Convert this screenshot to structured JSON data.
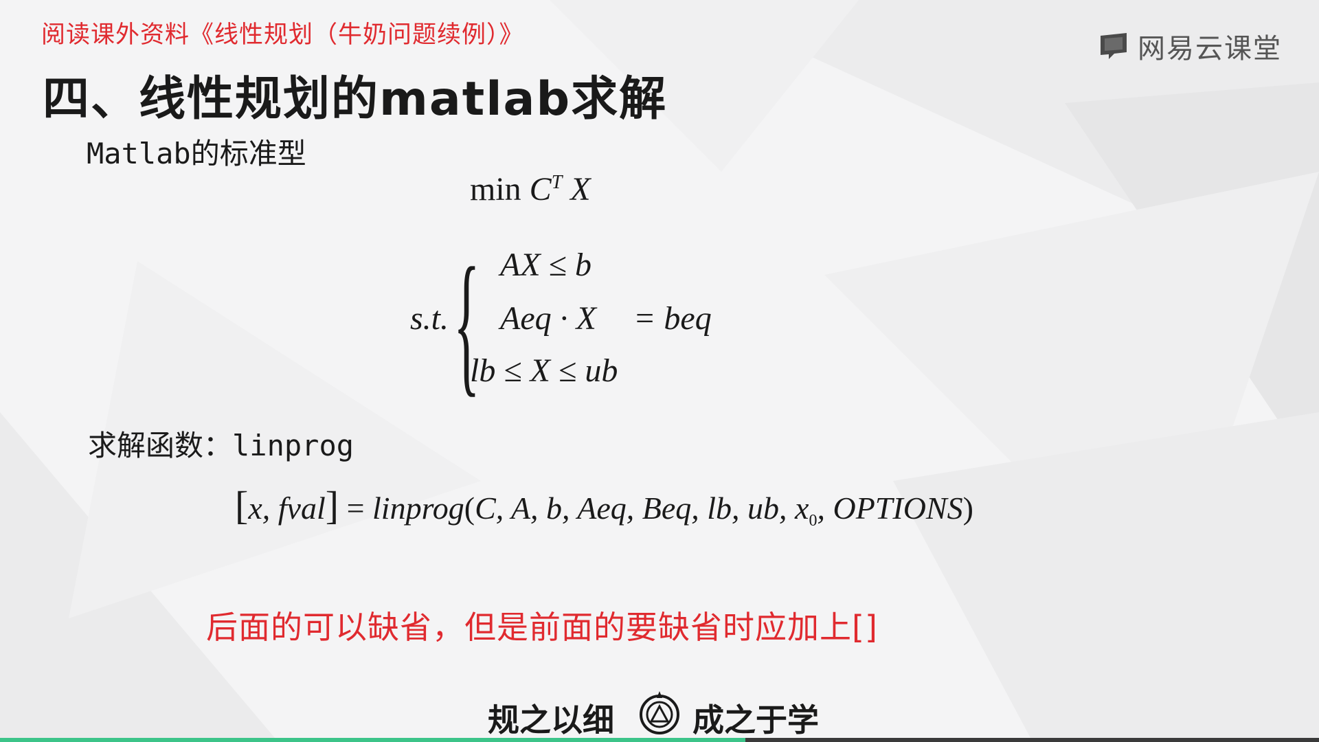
{
  "slide": {
    "top_note": "阅读课外资料《线性规划（牛奶问题续例）》",
    "logo_text": "网易云课堂",
    "heading": "四、线性规划的matlab求解",
    "subheading": "Matlab的标准型",
    "objective": {
      "min": "min",
      "C": "C",
      "T": "T",
      "X": "X"
    },
    "constraints": {
      "st": "s.t.",
      "row1": "AX ≤ b",
      "row2_left": "Aeq · X",
      "row2_right": "= beq",
      "row3": "lb ≤ X ≤ ub"
    },
    "solver_label": "求解函数：",
    "solver_name": "linprog",
    "call": {
      "lhs": "x, fval",
      "eq": "=",
      "func": "linprog",
      "args_before": "C, A, b, Aeq, Beq, lb, ub, x",
      "sub0": "0",
      "args_after": ", OPTIONS"
    },
    "red_note": "后面的可以缺省，但是前面的要缺省时应加上[]",
    "motto_left": "规之以细",
    "motto_right": "成之于学"
  },
  "progress": {
    "fraction": 0.565,
    "color": "#3cc489"
  }
}
